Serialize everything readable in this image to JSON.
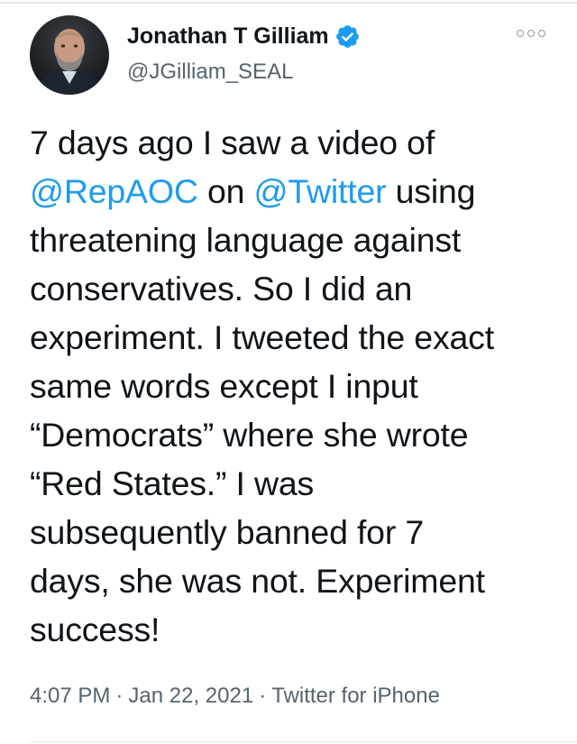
{
  "tweet": {
    "author": {
      "display_name": "Jonathan T Gilliam",
      "handle": "@JGilliam_SEAL",
      "verified": true,
      "avatar_icon": "profile-photo"
    },
    "more_icon": "more-options-icon",
    "text_lines": [
      [
        {
          "t": "7 days ago I saw a video of"
        }
      ],
      [
        {
          "t": "@RepAOC",
          "mention": true
        },
        {
          "t": " on "
        },
        {
          "t": "@Twitter",
          "mention": true
        },
        {
          "t": " using"
        }
      ],
      [
        {
          "t": "threatening language against"
        }
      ],
      [
        {
          "t": "conservatives. So I did an"
        }
      ],
      [
        {
          "t": "experiment. I tweeted the exact"
        }
      ],
      [
        {
          "t": "same words except I input"
        }
      ],
      [
        {
          "t": "“Democrats” where she wrote"
        }
      ],
      [
        {
          "t": "“Red States.” I was"
        }
      ],
      [
        {
          "t": "subsequently banned for 7"
        }
      ],
      [
        {
          "t": "days, she was not. Experiment"
        }
      ],
      [
        {
          "t": "success!"
        }
      ]
    ],
    "meta": {
      "time": "4:07 PM",
      "date": "Jan 22, 2021",
      "separator": "·",
      "source": "Twitter for iPhone"
    }
  },
  "colors": {
    "mention": "#1d9bf0",
    "verified": "#1d9bf0",
    "secondary_text": "#536471"
  }
}
